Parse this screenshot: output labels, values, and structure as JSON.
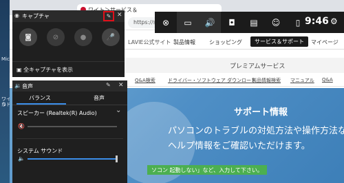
{
  "desktop": {
    "labels": [
      "Mic",
      "ワイル",
      "ウド"
    ]
  },
  "browser": {
    "tab_title": "ワイト＞サービス＆",
    "address": "https://s",
    "brand": "LAVIE公式サイト",
    "nav": [
      "製品情報",
      "ショッピング",
      "サービス＆サポート",
      "マイページ"
    ],
    "premium": "プレミアムサービス",
    "sublinks": [
      "Q&A検索",
      "ドライバー・ソフトウェア ダウンロード",
      "製品情報検索",
      "マニュアル",
      "Q&A"
    ],
    "hero_title": "サポート情報",
    "hero_lines": [
      "パソコンのトラブルの対処方法や操作方法など",
      "ヘルプ情報をご確認いただけます。"
    ],
    "hero_search": "ソコン 起動しない」など、入力して下さい。"
  },
  "gamebar": {
    "time": "9:46",
    "buttons": [
      "xbox-icon",
      "capture-icon",
      "audio-icon",
      "performance-icon",
      "resources-icon",
      "social-icon",
      "mouse-icon"
    ]
  },
  "capture": {
    "title": "キャプチャ",
    "show_all": "全キャプチャを表示"
  },
  "audio": {
    "title": "音声",
    "tab_balance": "バランス",
    "tab_voice": "音声",
    "speaker": "スピーカー (Realtek(R) Audio)",
    "system_sound": "システム サウンド",
    "speaker_level": 0.0,
    "system_level": 1.0
  },
  "colors": {
    "accent": "#3b8eea",
    "highlight": "#e0101a"
  }
}
